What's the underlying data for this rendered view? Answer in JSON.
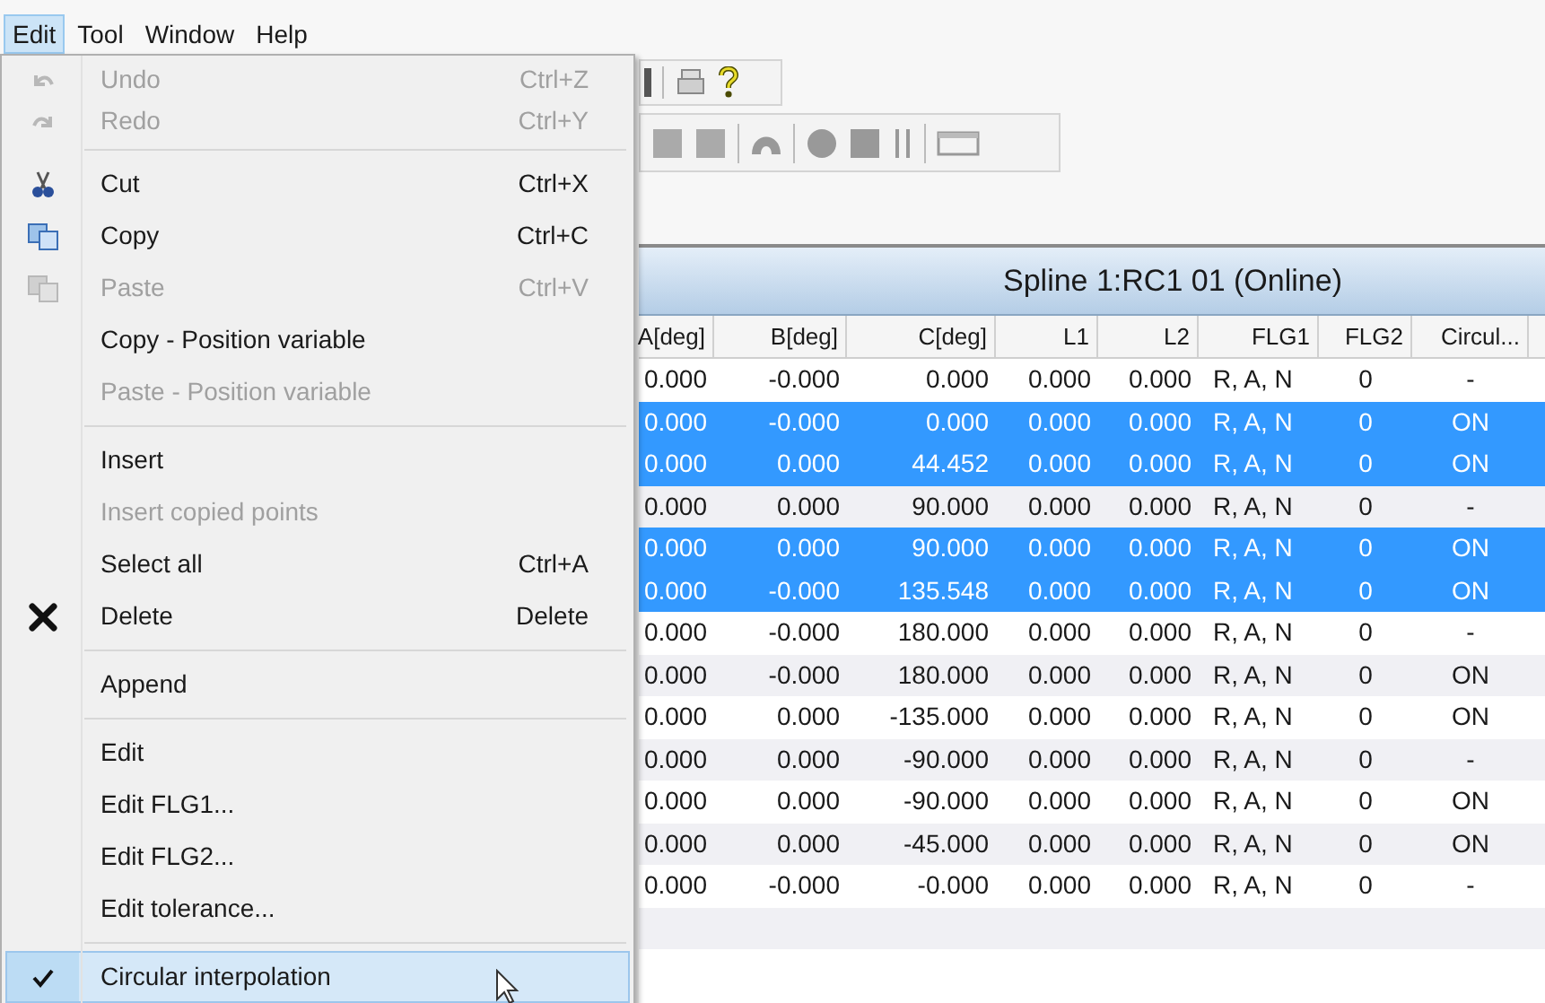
{
  "menubar": [
    {
      "label": "Edit",
      "selected": true
    },
    {
      "label": "Tool",
      "selected": false
    },
    {
      "label": "Window",
      "selected": false
    },
    {
      "label": "Help",
      "selected": false
    }
  ],
  "panel": {
    "title": "Spline 1:RC1 01 (Online)"
  },
  "table": {
    "columns": [
      "A[deg]",
      "B[deg]",
      "C[deg]",
      "L1",
      "L2",
      "FLG1",
      "FLG2",
      "Circul..."
    ],
    "rows": [
      {
        "selected": false,
        "cells": [
          "0.000",
          "-0.000",
          "0.000",
          "0.000",
          "0.000",
          "R, A, N",
          "0",
          "-"
        ]
      },
      {
        "selected": true,
        "cells": [
          "0.000",
          "-0.000",
          "0.000",
          "0.000",
          "0.000",
          "R, A, N",
          "0",
          "ON"
        ]
      },
      {
        "selected": true,
        "cells": [
          "0.000",
          "0.000",
          "44.452",
          "0.000",
          "0.000",
          "R, A, N",
          "0",
          "ON"
        ]
      },
      {
        "selected": false,
        "cells": [
          "0.000",
          "0.000",
          "90.000",
          "0.000",
          "0.000",
          "R, A, N",
          "0",
          "-"
        ]
      },
      {
        "selected": true,
        "cells": [
          "0.000",
          "0.000",
          "90.000",
          "0.000",
          "0.000",
          "R, A, N",
          "0",
          "ON"
        ]
      },
      {
        "selected": true,
        "cells": [
          "0.000",
          "-0.000",
          "135.548",
          "0.000",
          "0.000",
          "R, A, N",
          "0",
          "ON"
        ]
      },
      {
        "selected": false,
        "cells": [
          "0.000",
          "-0.000",
          "180.000",
          "0.000",
          "0.000",
          "R, A, N",
          "0",
          "-"
        ]
      },
      {
        "selected": false,
        "cells": [
          "0.000",
          "-0.000",
          "180.000",
          "0.000",
          "0.000",
          "R, A, N",
          "0",
          "ON"
        ]
      },
      {
        "selected": false,
        "cells": [
          "0.000",
          "0.000",
          "-135.000",
          "0.000",
          "0.000",
          "R, A, N",
          "0",
          "ON"
        ]
      },
      {
        "selected": false,
        "cells": [
          "0.000",
          "0.000",
          "-90.000",
          "0.000",
          "0.000",
          "R, A, N",
          "0",
          "-"
        ]
      },
      {
        "selected": false,
        "cells": [
          "0.000",
          "0.000",
          "-90.000",
          "0.000",
          "0.000",
          "R, A, N",
          "0",
          "ON"
        ]
      },
      {
        "selected": false,
        "cells": [
          "0.000",
          "0.000",
          "-45.000",
          "0.000",
          "0.000",
          "R, A, N",
          "0",
          "ON"
        ]
      },
      {
        "selected": false,
        "cells": [
          "0.000",
          "-0.000",
          "-0.000",
          "0.000",
          "0.000",
          "R, A, N",
          "0",
          "-"
        ]
      }
    ]
  },
  "edit_menu": [
    {
      "kind": "item",
      "label": "Undo",
      "shortcut": "Ctrl+Z",
      "disabled": true,
      "checked": false,
      "selected": false
    },
    {
      "kind": "item",
      "label": "Redo",
      "shortcut": "Ctrl+Y",
      "disabled": true,
      "checked": false,
      "selected": false
    },
    {
      "kind": "separator"
    },
    {
      "kind": "item",
      "label": "Cut",
      "shortcut": "Ctrl+X",
      "disabled": false,
      "checked": false,
      "selected": false
    },
    {
      "kind": "item",
      "label": "Copy",
      "shortcut": "Ctrl+C",
      "disabled": false,
      "checked": false,
      "selected": false
    },
    {
      "kind": "item",
      "label": "Paste",
      "shortcut": "Ctrl+V",
      "disabled": true,
      "checked": false,
      "selected": false
    },
    {
      "kind": "item",
      "label": "Copy - Position variable",
      "disabled": false,
      "checked": false,
      "selected": false
    },
    {
      "kind": "item",
      "label": "Paste - Position variable",
      "disabled": true,
      "checked": false,
      "selected": false
    },
    {
      "kind": "separator"
    },
    {
      "kind": "item",
      "label": "Insert",
      "disabled": false,
      "checked": false,
      "selected": false
    },
    {
      "kind": "item",
      "label": "Insert copied points",
      "disabled": true,
      "checked": false,
      "selected": false
    },
    {
      "kind": "item",
      "label": "Select all",
      "shortcut": "Ctrl+A",
      "disabled": false,
      "checked": false,
      "selected": false
    },
    {
      "kind": "item",
      "label": "Delete",
      "shortcut": "Delete",
      "disabled": false,
      "checked": false,
      "selected": false
    },
    {
      "kind": "separator"
    },
    {
      "kind": "item",
      "label": "Append",
      "disabled": false,
      "checked": false,
      "selected": false
    },
    {
      "kind": "separator"
    },
    {
      "kind": "item",
      "label": "Edit",
      "disabled": false,
      "checked": false,
      "selected": false
    },
    {
      "kind": "item",
      "label": "Edit FLG1...",
      "disabled": false,
      "checked": false,
      "selected": false
    },
    {
      "kind": "item",
      "label": "Edit FLG2...",
      "disabled": false,
      "checked": false,
      "selected": false
    },
    {
      "kind": "item",
      "label": "Edit tolerance...",
      "disabled": false,
      "checked": false,
      "selected": false
    },
    {
      "kind": "separator"
    },
    {
      "kind": "item",
      "label": "Circular interpolation",
      "disabled": false,
      "checked": true,
      "selected": true
    }
  ]
}
